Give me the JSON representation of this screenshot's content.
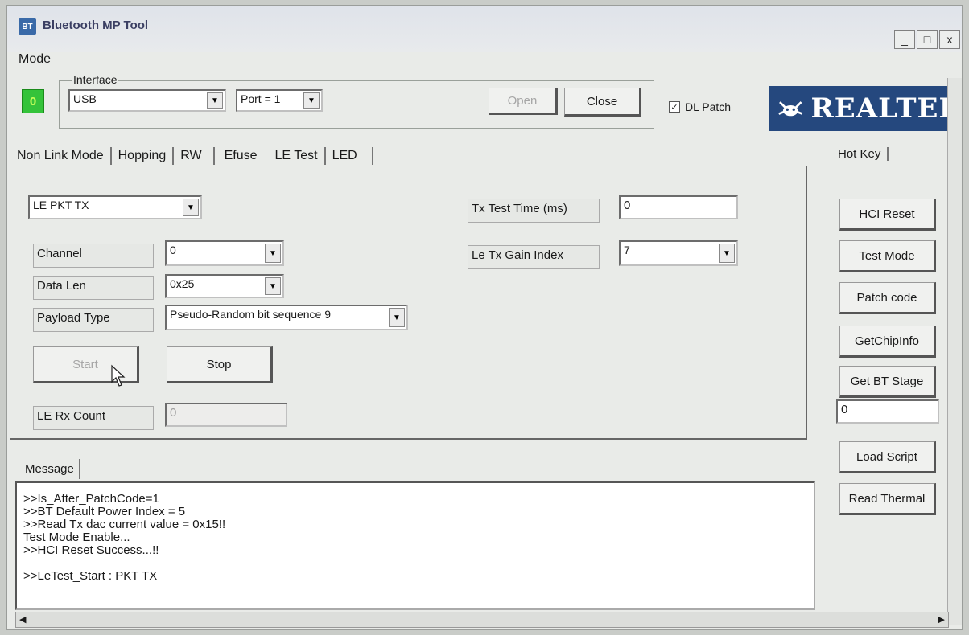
{
  "window": {
    "title": "Bluetooth MP Tool",
    "icon": "bt-app-icon",
    "controls": [
      "_",
      "□",
      "x"
    ]
  },
  "menu": {
    "mode": "Mode"
  },
  "status_led": {
    "value": "0",
    "color": "#34c33a"
  },
  "interface": {
    "group_label": "Interface",
    "type_value": "USB",
    "port_value": "Port = 1",
    "open_label": "Open",
    "close_label": "Close",
    "dl_patch_label": "DL Patch",
    "dl_patch_checked": true
  },
  "logo": {
    "text": "REALTEK",
    "color": "#25487e"
  },
  "tabs": [
    "Non Link Mode",
    "Hopping",
    "RW",
    "Efuse",
    "LE Test",
    "LED"
  ],
  "active_tab": "LE Test",
  "le_test": {
    "mode_value": "LE PKT TX",
    "tx_test_time_label": "Tx Test Time (ms)",
    "tx_test_time_value": "0",
    "channel_label": "Channel",
    "channel_value": "0",
    "gain_label": "Le Tx Gain Index",
    "gain_value": "7",
    "data_len_label": "Data Len",
    "data_len_value": "0x25",
    "payload_label": "Payload Type",
    "payload_value": "Pseudo-Random bit sequence 9",
    "start_label": "Start",
    "stop_label": "Stop",
    "rx_count_label": "LE Rx Count",
    "rx_count_value": "0"
  },
  "hotkey": {
    "tab_label": "Hot Key",
    "hci_reset": "HCI Reset",
    "test_mode": "Test Mode",
    "patch_code": "Patch code",
    "get_chip_info": "GetChipInfo",
    "get_bt_stage": "Get BT Stage",
    "bt_stage_value": "0",
    "load_script": "Load Script",
    "read_thermal": "Read Thermal"
  },
  "message": {
    "tab_label": "Message",
    "lines": [
      ">>Is_After_PatchCode=1",
      ">>BT Default Power Index = 5",
      ">>Read Tx dac current value = 0x15!!",
      "Test Mode Enable...",
      ">>HCI Reset Success...!!",
      "",
      ">>LeTest_Start : PKT TX"
    ]
  }
}
